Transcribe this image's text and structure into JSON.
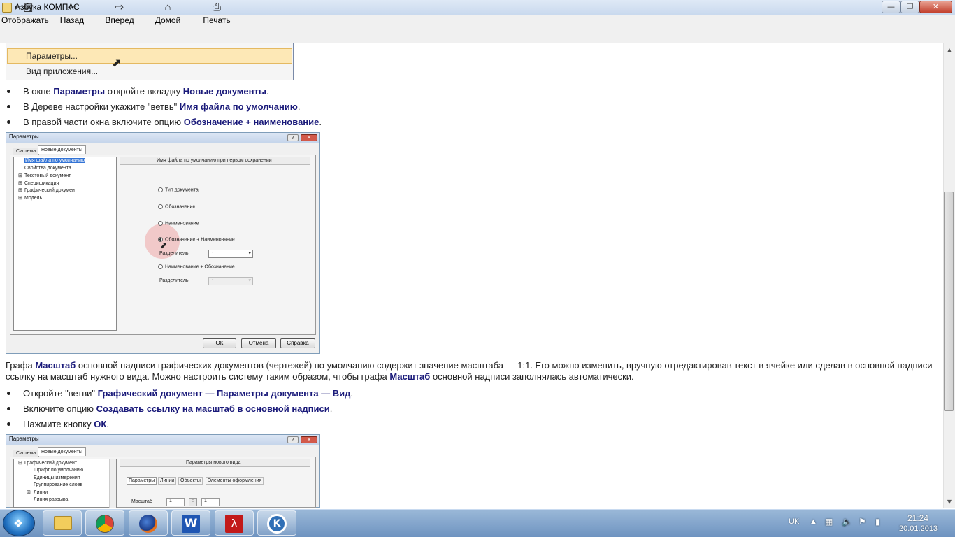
{
  "window": {
    "title": "Азбука КОМПАС",
    "min_icon": "minimize-icon",
    "max_icon": "maximize-icon",
    "close_icon": "close-icon"
  },
  "toolbar": {
    "show": "Отображать",
    "back": "Назад",
    "forward": "Вперед",
    "home": "Домой",
    "print": "Печать"
  },
  "menu": {
    "item1": "Параметры...",
    "item2": "Вид приложения..."
  },
  "bullets1": {
    "b1_pre": "В окне ",
    "b1_h1": "Параметры",
    "b1_mid": " откройте вкладку ",
    "b1_h2": "Новые документы",
    "b1_end": ".",
    "b2_pre": "В Дереве настройки укажите \"ветвь\" ",
    "b2_h": "Имя файла по умолчанию",
    "b2_end": ".",
    "b3_pre": "В правой части окна включите опцию ",
    "b3_h": "Обозначение + наименование",
    "b3_end": "."
  },
  "dialog1": {
    "title": "Параметры",
    "tab_system": "Система",
    "tab_newdocs": "Новые документы",
    "tree": [
      "Имя файла по умолчанию",
      "Свойства документа",
      "Текстовый документ",
      "Спецификация",
      "Графический документ",
      "Модель"
    ],
    "panel_header": "Имя файла по умолчанию при первом сохранении",
    "opt1": "Тип документа",
    "opt2": "Обозначение",
    "opt3": "Наименование",
    "opt4": "Обозначение + Наименование",
    "sep_label": "Разделитель:",
    "sep_value": "-",
    "opt5": "Наименование + Обозначение",
    "sep_label2": "Разделитель:",
    "sep_value2": "-",
    "ok": "ОК",
    "cancel": "Отмена",
    "help": "Справка"
  },
  "paragraph": {
    "p1": "Графа ",
    "h1": "Масштаб",
    "p2": " основной надписи графических документов (чертежей) по умолчанию содержит значение масштаба — 1:1. Его можно изменить, вручную отредактировав текст в ячейке или сделав в основной надписи",
    "p3": "ссылку на масштаб нужного вида. Можно настроить систему таким образом, чтобы графа ",
    "h2": "Масштаб",
    "p4": " основной надписи заполнялась автоматически."
  },
  "bullets2": {
    "b1_pre": "Откройте \"ветви\" ",
    "b1_h": "Графический документ — Параметры документа — Вид",
    "b1_end": ".",
    "b2_pre": "Включите опцию ",
    "b2_h": "Создавать ссылку на масштаб в основной надписи",
    "b2_end": ".",
    "b3_pre": "Нажмите кнопку ",
    "b3_h": "ОК",
    "b3_end": "."
  },
  "dialog2": {
    "title": "Параметры",
    "tab_system": "Система",
    "tab_newdocs": "Новые документы",
    "tree": [
      "Графический документ",
      "Шрифт по умолчанию",
      "Единицы измерения",
      "Группирование слоев",
      "Линии",
      "Линия разрыва"
    ],
    "panel_header": "Параметры нового вида",
    "tabs": [
      "Параметры",
      "Линии",
      "Объекты",
      "Элементы оформления"
    ],
    "scale_label": "Масштаб",
    "scale_v1": "1",
    "scale_v2": "1"
  },
  "taskbar": {
    "lang": "UK",
    "time": "21:24",
    "date": "20.01.2013"
  }
}
